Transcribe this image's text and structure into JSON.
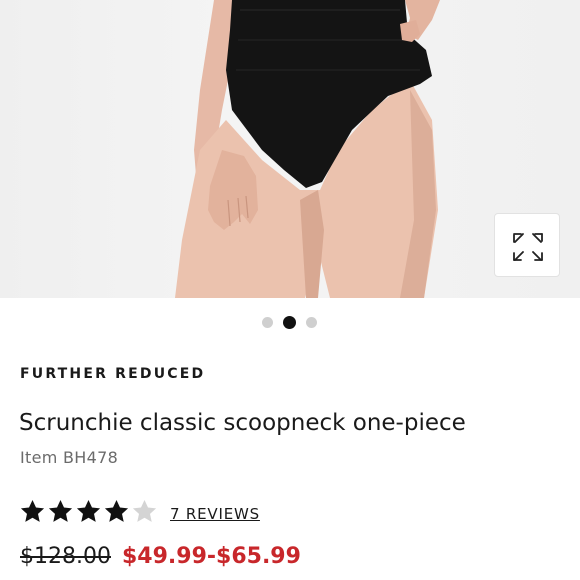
{
  "product": {
    "badge": "FURTHER REDUCED",
    "name": "Scrunchie classic scoopneck one-piece",
    "item_number": "Item BH478",
    "rating": {
      "value": 4,
      "max": 5
    },
    "reviews_link": "7 REVIEWS",
    "price_original": "$128.00",
    "price_sale": "$49.99-$65.99"
  },
  "gallery": {
    "slide_count": 3,
    "active_slide": 2
  },
  "icons": {
    "expand": "expand-arrows-icon",
    "star_filled": "star-filled-icon",
    "star_empty": "star-empty-icon"
  },
  "colors": {
    "sale_price": "#c8272b",
    "text": "#1a1a1a",
    "muted_text": "#6b6b6b",
    "star_filled": "#111111",
    "star_empty": "#d4d4d4",
    "dot_inactive": "#cfcfcf",
    "dot_active": "#111111"
  }
}
